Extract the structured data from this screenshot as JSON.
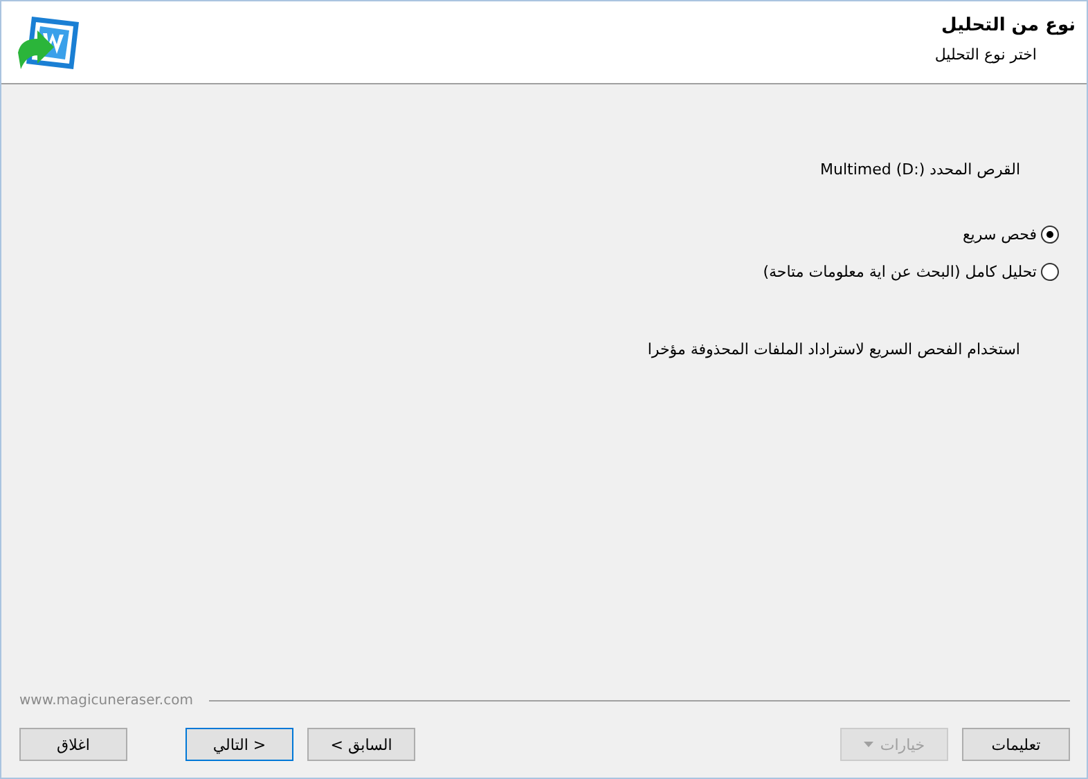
{
  "header": {
    "title": "نوع من التحليل",
    "subtitle": "اختر نوع التحليل"
  },
  "disk_label": "القرص المحدد Multimed (D:)",
  "scan_options": [
    {
      "label": "فحص سريع",
      "selected": true
    },
    {
      "label": "تحليل كامل (البحث عن اية معلومات متاحة)",
      "selected": false
    }
  ],
  "description": "استخدام الفحص السريع لاستراداد الملفات المحذوفة مؤخرا",
  "website": "www.magicuneraser.com",
  "buttons": [
    {
      "label": "تعليمات",
      "kind": "plain",
      "disabled": false,
      "focused": false
    },
    {
      "label": "خيارات",
      "kind": "dropdown",
      "disabled": true,
      "focused": false
    },
    {
      "label": "< السابق",
      "kind": "plain",
      "disabled": false,
      "focused": false
    },
    {
      "label": "التالي >",
      "kind": "plain",
      "disabled": false,
      "focused": true
    },
    {
      "label": "اغلاق",
      "kind": "plain",
      "disabled": false,
      "focused": false
    }
  ]
}
